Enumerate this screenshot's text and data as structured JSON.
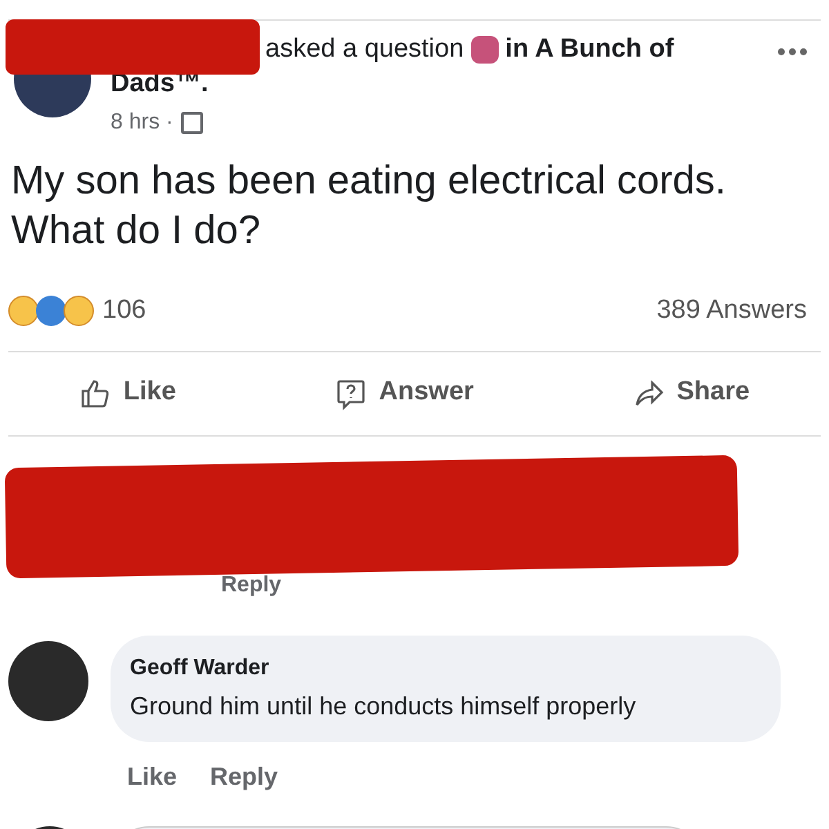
{
  "post": {
    "header_text": "asked a question",
    "group_prefix": "in A Bunch of",
    "group_rest": "Dads™.",
    "time": "8 hrs ·",
    "question": "My son has been eating electrical cords. What do I do?"
  },
  "reactions": {
    "count": "106",
    "answers": "389 Answers"
  },
  "actions": [
    {
      "kind": "like",
      "label": "Like"
    },
    {
      "kind": "answer",
      "label": "Answer"
    },
    {
      "kind": "share",
      "label": "Share"
    }
  ],
  "redacted_comment": {
    "reply": "Reply"
  },
  "comment": {
    "author": "Geoff Warder",
    "text": "Ground him until he conducts himself properly",
    "links": [
      "Like",
      "Reply"
    ]
  }
}
